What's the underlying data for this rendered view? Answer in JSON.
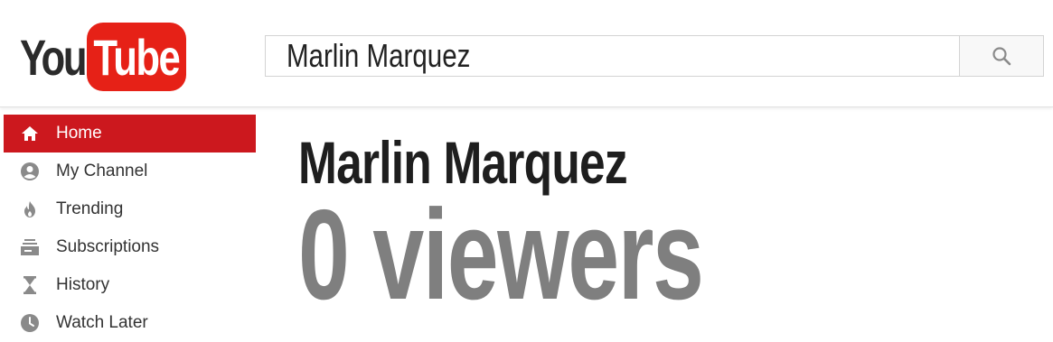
{
  "logo": {
    "you": "You",
    "tube": "Tube"
  },
  "search": {
    "value": "Marlin Marquez",
    "icon": "search-icon"
  },
  "sidebar": {
    "items": [
      {
        "label": "Home",
        "icon": "home-icon",
        "active": true
      },
      {
        "label": "My Channel",
        "icon": "account-icon",
        "active": false
      },
      {
        "label": "Trending",
        "icon": "flame-icon",
        "active": false
      },
      {
        "label": "Subscriptions",
        "icon": "subscriptions-icon",
        "active": false
      },
      {
        "label": "History",
        "icon": "hourglass-icon",
        "active": false
      },
      {
        "label": "Watch Later",
        "icon": "clock-icon",
        "active": false
      }
    ]
  },
  "main": {
    "channel_name": "Marlin Marquez",
    "viewers_text": "0 viewers"
  },
  "colors": {
    "brand_red": "#e62117",
    "active_red": "#cc181e",
    "icon_gray": "#8a8a8a",
    "viewers_gray": "#7f7f7f"
  }
}
